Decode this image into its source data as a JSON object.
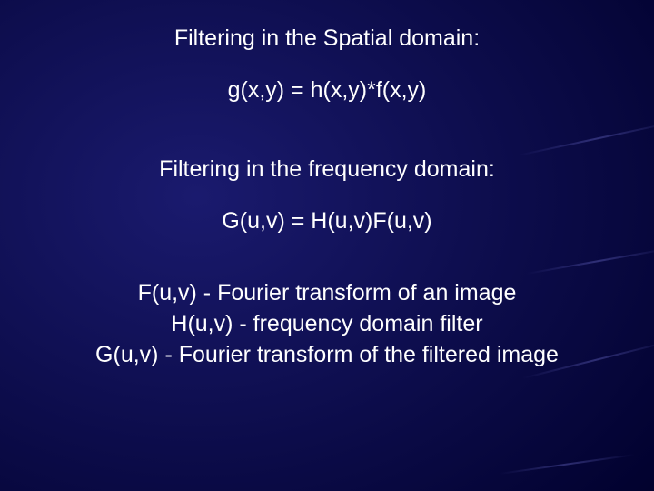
{
  "slide": {
    "heading_spatial": "Filtering in the Spatial domain:",
    "equation_spatial": "g(x,y) = h(x,y)*f(x,y)",
    "heading_frequency": "Filtering in the frequency domain:",
    "equation_frequency": "G(u,v) = H(u,v)F(u,v)",
    "definitions": {
      "line1": "F(u,v) - Fourier transform of an image",
      "line2": "H(u,v) - frequency domain filter",
      "line3": "G(u,v) - Fourier transform of the filtered image"
    }
  }
}
